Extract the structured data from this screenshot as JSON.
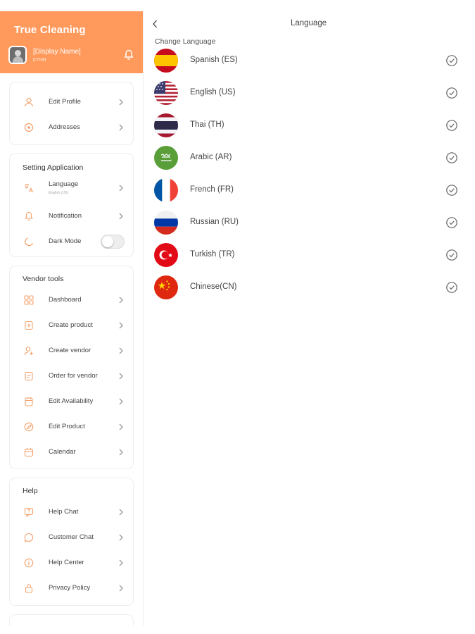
{
  "app": {
    "name": "True Cleaning"
  },
  "profile": {
    "display_name": "[Display Name]",
    "email": "[Email]"
  },
  "account_items": [
    {
      "label": "Edit Profile",
      "icon": "user-icon"
    },
    {
      "label": "Addresses",
      "icon": "location-icon"
    }
  ],
  "settings": {
    "title": "Setting Application",
    "language": {
      "label": "Language",
      "value": "English (US)",
      "icon": "translate-icon"
    },
    "notification": {
      "label": "Notification",
      "icon": "bell-icon"
    },
    "dark_mode": {
      "label": "Dark Mode",
      "enabled": false,
      "icon": "moon-icon"
    }
  },
  "vendor_tools": {
    "title": "Vendor tools",
    "items": [
      {
        "label": "Dashboard",
        "icon": "dashboard-icon"
      },
      {
        "label": "Create product",
        "icon": "create-product-icon"
      },
      {
        "label": "Create vendor",
        "icon": "create-vendor-icon"
      },
      {
        "label": "Order for vendor",
        "icon": "order-icon"
      },
      {
        "label": "Edit Availability",
        "icon": "availability-icon"
      },
      {
        "label": "Edit Product",
        "icon": "edit-product-icon"
      },
      {
        "label": "Calendar",
        "icon": "calendar-icon"
      }
    ]
  },
  "help": {
    "title": "Help",
    "items": [
      {
        "label": "Help Chat",
        "icon": "help-chat-icon"
      },
      {
        "label": "Customer Chat",
        "icon": "chat-icon"
      },
      {
        "label": "Help Center",
        "icon": "info-icon"
      },
      {
        "label": "Privacy Policy",
        "icon": "lock-icon"
      }
    ]
  },
  "main": {
    "title": "Language",
    "section_label": "Change Language",
    "languages": [
      {
        "label": "Spanish (ES)",
        "flag": "spain-flag-icon"
      },
      {
        "label": "English (US)",
        "flag": "us-flag-icon"
      },
      {
        "label": "Thai (TH)",
        "flag": "thailand-flag-icon"
      },
      {
        "label": "Arabic (AR)",
        "flag": "saudi-arabia-flag-icon"
      },
      {
        "label": "French (FR)",
        "flag": "france-flag-icon"
      },
      {
        "label": "Russian (RU)",
        "flag": "russia-flag-icon"
      },
      {
        "label": "Turkish (TR)",
        "flag": "turkey-flag-icon"
      },
      {
        "label": "Chinese(CN)",
        "flag": "china-flag-icon"
      }
    ]
  },
  "colors": {
    "accent": "#ff9a5c",
    "icon": "#f4a06a",
    "chevron": "#999999",
    "check": "#666666"
  }
}
